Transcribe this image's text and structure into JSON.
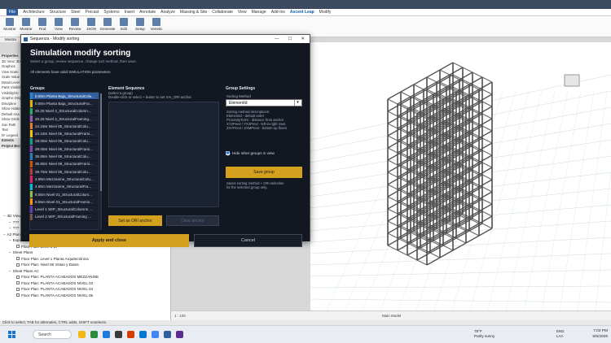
{
  "ribbon": {
    "tabs": [
      "File",
      "Architecture",
      "Structure",
      "Steel",
      "Precast",
      "Systems",
      "Insert",
      "Annotate",
      "Analyze",
      "Massing & Site",
      "Collaborate",
      "View",
      "Manage",
      "Add-Ins",
      "Ascent Leap",
      "Modify"
    ],
    "active_tab": "Ascent Leap",
    "buttons": [
      "Mostrar",
      "Mostrar",
      "Find",
      "View",
      "Review",
      "JSON",
      "Generate",
      "Edit",
      "Setup",
      "Venetic"
    ],
    "pane_label": "Mostra"
  },
  "properties": {
    "header": "Properties",
    "rows": [
      "3D View: 3D",
      "Graphics",
      "View Scale",
      "Scale Value",
      "Detail Level",
      "Parts Visibility",
      "Visibility/Gr",
      "Graphic Disp",
      "Discipline",
      "Show Hidden",
      "Default Ana",
      "Show Grids",
      "Sun Path",
      "Text",
      "N* Legend"
    ],
    "sections": [
      "Extents"
    ],
    "browser_header": "Project Browser"
  },
  "browser": {
    "items": [
      {
        "label": "3D Views",
        "level": 1,
        "box": false
      },
      {
        "label": "???",
        "level": 2,
        "box": false
      },
      {
        "label": "???",
        "level": 2,
        "box": false
      },
      {
        "label": "A2 Plantas Arquitectonicas",
        "level": 1,
        "box": false
      },
      {
        "label": "Export Plans",
        "level": 2,
        "box": false
      },
      {
        "label": "Floor Plan: Level 1 EP",
        "level": 3,
        "box": true
      },
      {
        "label": "Sheet Plans",
        "level": 2,
        "box": false
      },
      {
        "label": "Floor Plan: Level 1 Planta Arquitectónica",
        "level": 3,
        "box": true
      },
      {
        "label": "Floor Plan: Nivel 08 Vistas y Datos",
        "level": 3,
        "box": true
      },
      {
        "label": "Sheet Plans AC",
        "level": 2,
        "box": false
      },
      {
        "label": "Floor Plan: PLANTA ACABADOS MEZZANINE",
        "level": 3,
        "box": true
      },
      {
        "label": "Floor Plan: PLANTA ACABADOS NIVEL 03",
        "level": 3,
        "box": true
      },
      {
        "label": "Floor Plan: PLANTA ACABADOS NIVEL 04",
        "level": 3,
        "box": true
      },
      {
        "label": "Floor Plan: PLANTA ACABADOS NIVEL 05",
        "level": 3,
        "box": true
      }
    ]
  },
  "dialog": {
    "window_title": "Sequenza - Modify sorting",
    "title": "Simulation modify sorting",
    "subtitle": "Select a group, review sequence, change sort method, then save.",
    "note": "All elements have valid SIMULATION parameters",
    "groups_label": "Groups",
    "groups": [
      {
        "label": "0.00m Planta Baja_StructuralColu...",
        "color": "#1d8ce0",
        "selected": true
      },
      {
        "label": "0.00m Planta Baja_StructuralFra...",
        "color": "#e3b20a",
        "selected": false
      },
      {
        "label": "20.25 Nivel 4_StructuralColumn...",
        "color": "#27ae60",
        "selected": false
      },
      {
        "label": "20.25 Nivel 4_StructuralFraming...",
        "color": "#9b59b6",
        "selected": false
      },
      {
        "label": "24.15m Nivel 05_StructuralColu...",
        "color": "#e67e22",
        "selected": false
      },
      {
        "label": "24.15m Nivel 05_StructuralFrami...",
        "color": "#f1c40f",
        "selected": false
      },
      {
        "label": "28.05m Nivel 06_StructuralColu...",
        "color": "#16a085",
        "selected": false
      },
      {
        "label": "28.05m Nivel 06_StructuralFrami...",
        "color": "#8e44ad",
        "selected": false
      },
      {
        "label": "35.85m Nivel 08_StructuralColu...",
        "color": "#2980b9",
        "selected": false
      },
      {
        "label": "35.85m Nivel 08_StructuralFrami...",
        "color": "#d35400",
        "selected": false
      },
      {
        "label": "39.75m Nivel 09_StructuralColu...",
        "color": "#c0392b",
        "selected": false
      },
      {
        "label": "4.85m Mezzanine_StructuralColu...",
        "color": "#e91e63",
        "selected": false
      },
      {
        "label": "4.85m Mezzanine_StructuralFra...",
        "color": "#00bcd4",
        "selected": false
      },
      {
        "label": "8.55m Nivel 01_StructuralColum...",
        "color": "#8bc34a",
        "selected": false
      },
      {
        "label": "8.55m Nivel 01_StructuralFramin...",
        "color": "#ff9800",
        "selected": false
      },
      {
        "label": "Level 1 WIP_StructuralColumns ...",
        "color": "#673ab7",
        "selected": false
      },
      {
        "label": "Level 2 WIP_StructuralFraming ...",
        "color": "#795548",
        "selected": false
      }
    ],
    "sequence_label": "Element Sequence",
    "sequence_hint": [
      "(select a group)",
      "Double-click or select + button to set XAI_ORI anchor."
    ],
    "set_origin_label": "Set as ORI anchor",
    "clear_label": "Clear anchor",
    "settings_label": "Group Settings",
    "sorting_label": "Sorting Method",
    "sorting_value": "ElementId",
    "sorting_desc": [
      "Sorting method descriptions:",
      "ElementId - default order",
      "ProximityToXX - distance from anchor",
      "XY2Prevt / YX2Prevt - left-to-right rows",
      "ZXYPrevt / ZXMPrevt - bottom-up floors"
    ],
    "hide_label": "Hide other groups in view",
    "save_label": "Save group",
    "save_note": [
      "Saves sorting method + ORI selection",
      "for the selected group only."
    ],
    "apply_label": "Apply and close",
    "cancel_label": "Cancel"
  },
  "viewport": {
    "status": "1 : 100",
    "model_label": "Main Model"
  },
  "statusbar": {
    "text": "Click to select, TAB for alternates, CTRL adds, SHIFT unselects."
  },
  "taskbar": {
    "search": "Search",
    "weather_temp": "78°F",
    "weather_desc": "Partly sunny",
    "lang1": "ENG",
    "lang2": "LAA",
    "time": "7:03 PM",
    "date": "5/5/2026"
  }
}
